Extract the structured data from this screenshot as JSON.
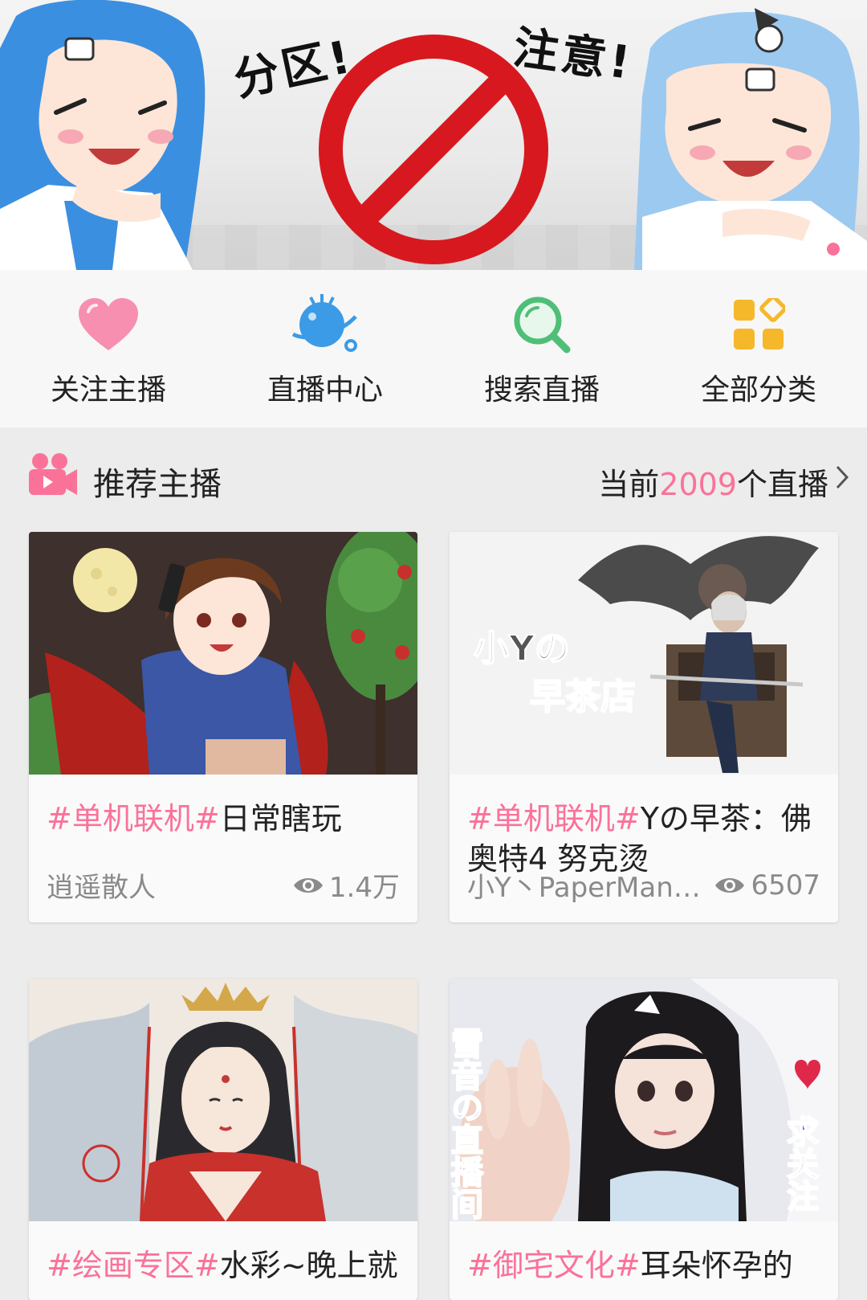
{
  "banner": {
    "text_left": "分区!",
    "text_right": "注意!",
    "colors": {
      "no_sign": "#d7191f",
      "hair": "#3b8fe0",
      "accent": "#fb7299"
    },
    "pager_dot_icon": "pager-dot"
  },
  "quicknav": [
    {
      "label": "关注主播",
      "icon": "heart-icon",
      "color": "#f68fb0"
    },
    {
      "label": "直播中心",
      "icon": "planet-icon",
      "color": "#3b9be6"
    },
    {
      "label": "搜索直播",
      "icon": "search-icon",
      "color": "#4fbf78"
    },
    {
      "label": "全部分类",
      "icon": "grid-icon",
      "color": "#f5b82a"
    }
  ],
  "section": {
    "title": "推荐主播",
    "count_prefix": "当前",
    "count": "2009",
    "count_suffix": "个直播",
    "icon": "camera-icon",
    "accent": "#fb7299"
  },
  "cards": [
    {
      "tag": "#单机联机#",
      "title": "日常瞎玩",
      "author": "逍遥散人",
      "views": "1.4万"
    },
    {
      "tag": "#单机联机#",
      "title": "Yの早茶：佛奥特4 努克烫",
      "author": "小Y丶PaperMannn...",
      "views": "6507",
      "thumb_text_1": "小Yの",
      "thumb_text_2": "早茶店"
    },
    {
      "tag": "#绘画专区#",
      "title": "水彩~晚上就",
      "author": "",
      "views": ""
    },
    {
      "tag": "#御宅文化#",
      "title": "耳朵怀孕的",
      "author": "",
      "views": "",
      "thumb_text_1": "雪音の直播间",
      "thumb_text_2": "求关注"
    }
  ]
}
